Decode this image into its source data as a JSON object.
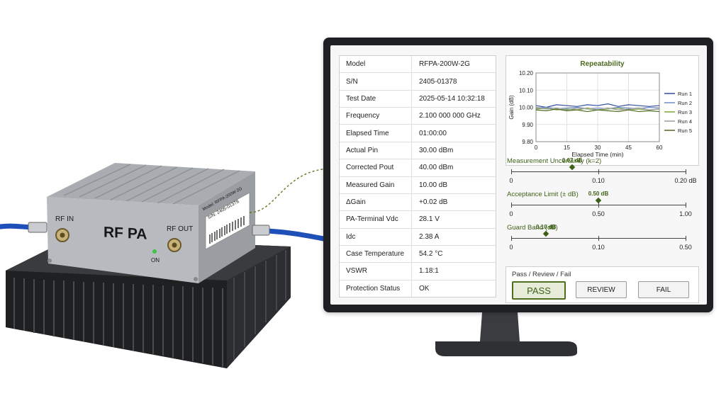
{
  "device": {
    "label_main": "RF PA",
    "port_in_label": "RF IN",
    "port_out_label": "RF OUT",
    "led_label": "ON",
    "sticker_model": "Model: RFPA-200W-2G",
    "sticker_sn": "S/N: 2405-01378"
  },
  "spec_table": [
    {
      "label": "Model",
      "value": "RFPA-200W-2G"
    },
    {
      "label": "S/N",
      "value": "2405-01378"
    },
    {
      "label": "Test Date",
      "value": "2025-05-14 10:32:18"
    },
    {
      "label": "Frequency",
      "value": "2.100 000 000 GHz"
    },
    {
      "label": "Elapsed Time",
      "value": "01:00:00"
    },
    {
      "label": "Actual Pin",
      "value": "30.00 dBm"
    },
    {
      "label": "Corrected Pout",
      "value": "40.00 dBm"
    },
    {
      "label": "Measured Gain",
      "value": "10.00 dB"
    },
    {
      "label": "ΔGain",
      "value": "+0.02 dB"
    },
    {
      "label": "PA-Terminal Vdc",
      "value": "28.1 V"
    },
    {
      "label": "Idc",
      "value": "2.38 A"
    },
    {
      "label": "Case Temperature",
      "value": "54.2 °C"
    },
    {
      "label": "VSWR",
      "value": "1.18:1"
    },
    {
      "label": "Protection Status",
      "value": "OK"
    }
  ],
  "chart_data": {
    "type": "line",
    "title": "Repeatability",
    "xlabel": "Elapsed Time (min)",
    "ylabel": "Gain (dB)",
    "xlim": [
      0,
      60
    ],
    "ylim": [
      9.8,
      10.2
    ],
    "xticks": [
      0,
      15,
      30,
      45,
      60
    ],
    "yticks": [
      "10.20",
      "10.10",
      "10.00",
      "9.90",
      "9.80"
    ],
    "grid": true,
    "legend_position": "right",
    "x": [
      0,
      5,
      10,
      15,
      20,
      25,
      30,
      35,
      40,
      45,
      50,
      55,
      60
    ],
    "series": [
      {
        "name": "Run 1",
        "color": "#2f4fa6",
        "values": [
          10.01,
          10.0,
          10.015,
          10.01,
          10.005,
          10.015,
          10.01,
          10.02,
          10.005,
          10.015,
          10.01,
          10.005,
          10.01
        ]
      },
      {
        "name": "Run 2",
        "color": "#6f8cc9",
        "values": [
          9.995,
          10.0,
          9.99,
          9.995,
          10.0,
          9.99,
          9.995,
          9.99,
          10.0,
          9.995,
          9.99,
          10.0,
          9.995
        ]
      },
      {
        "name": "Run 3",
        "color": "#7ea33a",
        "values": [
          9.99,
          9.995,
          9.985,
          9.99,
          9.985,
          9.995,
          9.985,
          9.99,
          9.995,
          9.985,
          9.99,
          9.985,
          9.99
        ]
      },
      {
        "name": "Run 4",
        "color": "#9a9a9a",
        "values": [
          10.0,
          9.99,
          9.995,
          9.985,
          9.995,
          9.99,
          9.985,
          9.995,
          9.985,
          9.99,
          9.995,
          9.985,
          9.99
        ]
      },
      {
        "name": "Run 5",
        "color": "#4d6b1e",
        "values": [
          9.985,
          9.98,
          9.99,
          9.98,
          9.985,
          9.975,
          9.985,
          9.98,
          9.975,
          9.985,
          9.975,
          9.98,
          9.975
        ]
      }
    ]
  },
  "gauges": [
    {
      "label": "Measurement Uncertainty (k=2)",
      "value_text": "0.07 dB",
      "value": 0.07,
      "min": 0,
      "max": 0.2,
      "ticks": [
        "0",
        "0.10",
        "0.20 dB"
      ]
    },
    {
      "label": "Acceptance Limit (± dB)",
      "value_text": "0.50 dB",
      "value": 0.5,
      "min": 0,
      "max": 1.0,
      "ticks": [
        "0",
        "0.50",
        "1.00"
      ]
    },
    {
      "label": "Guard Band (dB)",
      "value_text": "0.10 dB",
      "value": 0.1,
      "min": 0,
      "max": 0.5,
      "ticks": [
        "0",
        "0.10",
        "0.50"
      ]
    }
  ],
  "verdict": {
    "title": "Pass / Review / Fail",
    "pass_label": "PASS",
    "review_label": "REVIEW",
    "fail_label": "FAIL",
    "selected": "PASS"
  },
  "colors": {
    "accent_green": "#4d6f1f",
    "monitor_bezel": "#1d1f22",
    "cable_blue": "#1f4fb8"
  }
}
